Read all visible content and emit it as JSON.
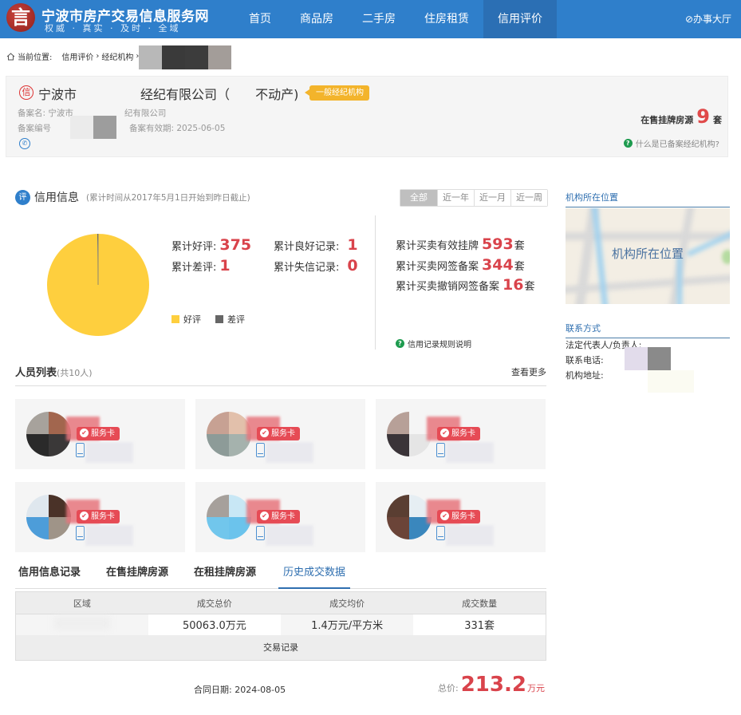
{
  "header": {
    "logo_glyph": "言",
    "site_title": "宁波市房产交易信息服务网",
    "site_subtitle": "权威 · 真实 · 及时 · 全域",
    "nav": [
      {
        "label": "首页",
        "active": false
      },
      {
        "label": "商品房",
        "active": false
      },
      {
        "label": "二手房",
        "active": false
      },
      {
        "label": "住房租赁",
        "active": false
      },
      {
        "label": "信用评价",
        "active": true
      }
    ],
    "office_label": "⊘办事大厅"
  },
  "breadcrumb": {
    "prefix": "当前位置:",
    "items": [
      "信用评价",
      "经纪机构"
    ],
    "separator": "›"
  },
  "agency": {
    "icon_glyph": "信",
    "name_visible_start": "宁波市",
    "name_visible_mid": "经纪有限公司（",
    "name_visible_end": "不动产)",
    "tag": "一般经纪机构",
    "record_name_label": "备案名: 宁波市",
    "record_name_tail": "纪有限公司",
    "record_no_label": "备案编号",
    "valid_label": "备案有效期: 2025-06-05",
    "listing_label": "在售挂牌房源",
    "listing_count": "9",
    "listing_unit": "套",
    "what_is_link": "什么是已备案经纪机构?"
  },
  "credit": {
    "icon_glyph": "评",
    "title": "信用信息",
    "note": "(累计时间从2017年5月1日开始到昨日截止)",
    "ranges": [
      {
        "label": "全部",
        "active": true
      },
      {
        "label": "近一年",
        "active": false
      },
      {
        "label": "近一月",
        "active": false
      },
      {
        "label": "近一周",
        "active": false
      }
    ],
    "stats": {
      "good_label": "累计好评:",
      "good_value": "375",
      "bad_label": "累计差评:",
      "bad_value": "1",
      "good_record_label": "累计良好记录:",
      "good_record_value": "1",
      "bad_record_label": "累计失信记录:",
      "bad_record_value": "0"
    },
    "trade_stats": [
      {
        "label": "累计买卖有效挂牌",
        "value": "593",
        "unit": "套"
      },
      {
        "label": "累计买卖网签备案",
        "value": "344",
        "unit": "套"
      },
      {
        "label": "累计买卖撤销网签备案",
        "value": "16",
        "unit": "套"
      }
    ],
    "rules_link": "信用记录规则说明"
  },
  "chart_data": {
    "type": "pie",
    "title": "",
    "labels": [
      "好评",
      "差评"
    ],
    "values": [
      375,
      1
    ],
    "colors": [
      "#fecf3e",
      "#666666"
    ],
    "legend": "bottom-right"
  },
  "sidebar": {
    "location_title": "机构所在位置",
    "map_label": "机构所在位置",
    "contact_title": "联系方式",
    "legal_rep_label": "法定代表人/负责人:",
    "phone_label": "联系电话:",
    "address_label": "机构地址:"
  },
  "staff": {
    "title": "人员列表",
    "count": "(共10人)",
    "more": "查看更多",
    "badge": "服务卡",
    "cards": [
      {
        "colors": [
          "#a7a29c",
          "#a2664e",
          "#2a2a2a",
          "#3a3838"
        ]
      },
      {
        "colors": [
          "#c7a193",
          "#e2c0ab",
          "#8d9b98",
          "#a5b2ad"
        ]
      },
      {
        "colors": [
          "#b7a098",
          "#f5f5f5",
          "#3a3438",
          "#e5e5e5"
        ]
      },
      {
        "colors": [
          "#dfe7ee",
          "#4a3228",
          "#4d9dd9",
          "#9f9488"
        ]
      },
      {
        "colors": [
          "#a6a09b",
          "#c8e7f5",
          "#71c6ec",
          "#6bc3ec"
        ]
      },
      {
        "colors": [
          "#5a3e32",
          "#e6eef3",
          "#6b4438",
          "#3a87bd"
        ]
      }
    ]
  },
  "tabs": [
    {
      "label": "信用信息记录",
      "active": false
    },
    {
      "label": "在售挂牌房源",
      "active": false
    },
    {
      "label": "在租挂牌房源",
      "active": false
    },
    {
      "label": "历史成交数据",
      "active": true
    }
  ],
  "history_table": {
    "headers": [
      "区域",
      "成交总价",
      "成交均价",
      "成交数量"
    ],
    "row": [
      "",
      "50063.0万元",
      "1.4万元/平方米",
      "331套"
    ],
    "footer": "交易记录"
  },
  "deal": {
    "date_label": "合同日期: 2024-08-05",
    "price_label": "总价:",
    "price_value": "213.2",
    "price_unit": "万元"
  }
}
